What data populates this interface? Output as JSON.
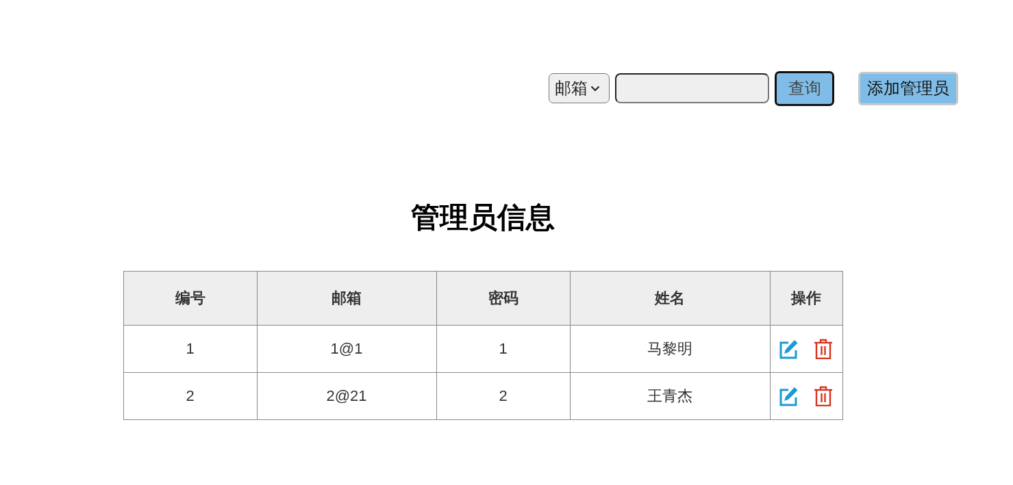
{
  "toolbar": {
    "field_select": {
      "value": "邮箱"
    },
    "search_button": "查询",
    "add_button": "添加管理员"
  },
  "title": "管理员信息",
  "table": {
    "columns": [
      "编号",
      "邮箱",
      "密码",
      "姓名",
      "操作"
    ],
    "rows": [
      {
        "cells": [
          "1",
          "1@1",
          "1",
          "马黎明"
        ]
      },
      {
        "cells": [
          "2",
          "2@21",
          "2",
          "王青杰"
        ]
      }
    ]
  }
}
